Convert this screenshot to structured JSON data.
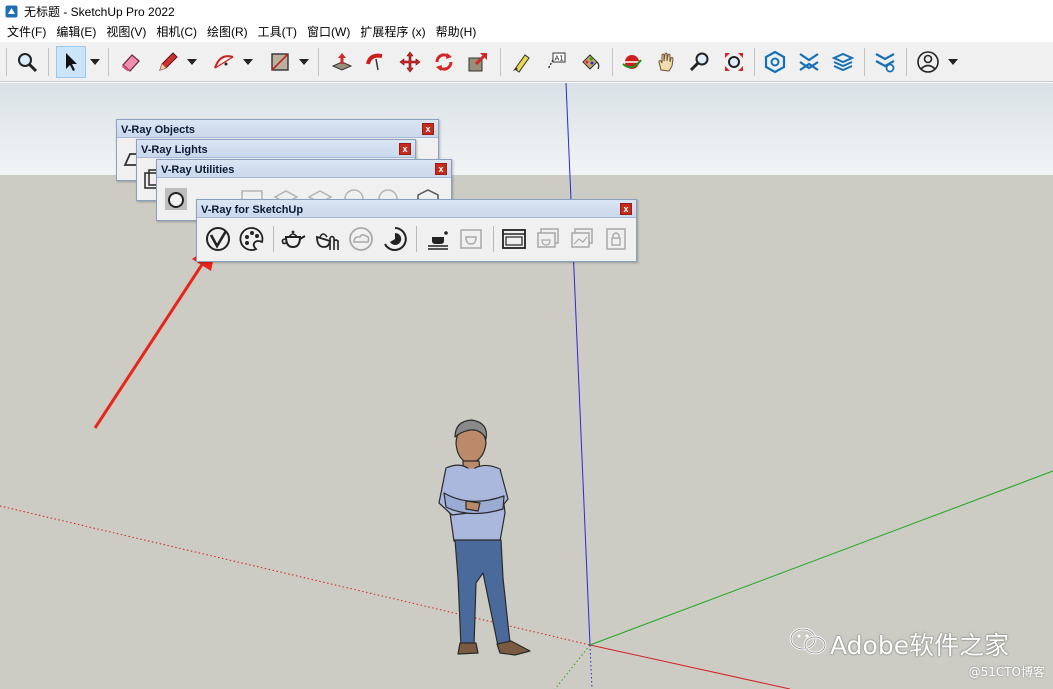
{
  "window": {
    "title": "无标题 - SketchUp Pro 2022"
  },
  "menu": [
    {
      "label": "文件(F)"
    },
    {
      "label": "编辑(E)"
    },
    {
      "label": "视图(V)"
    },
    {
      "label": "相机(C)"
    },
    {
      "label": "绘图(R)"
    },
    {
      "label": "工具(T)"
    },
    {
      "label": "窗口(W)"
    },
    {
      "label": "扩展程序 (x)"
    },
    {
      "label": "帮助(H)"
    }
  ],
  "toolbar": {
    "icons": [
      "zoom-icon",
      "select-icon",
      "eraser-icon",
      "pencil-icon",
      "arc-icon",
      "rectangle-icon",
      "push-pull-icon",
      "follow-me-icon",
      "move-icon",
      "rotate-icon",
      "scale-icon",
      "tape-measure-icon",
      "text-icon",
      "paint-bucket-icon",
      "orbit-icon",
      "pan-icon",
      "zoom-tool-icon",
      "zoom-extents-icon",
      "3d-warehouse-icon",
      "extension-warehouse-icon",
      "layout-icon",
      "extension-manager-icon",
      "account-icon"
    ]
  },
  "panels": {
    "objects": {
      "title": "V-Ray Objects",
      "close": "x"
    },
    "lights": {
      "title": "V-Ray Lights",
      "close": "x"
    },
    "utilities": {
      "title": "V-Ray Utilities",
      "close": "x"
    },
    "main": {
      "title": "V-Ray for SketchUp",
      "close": "x"
    }
  },
  "watermark": {
    "text": "Adobe软件之家",
    "sub": "@51CTO博客"
  },
  "colors": {
    "sky": "#e9eef1",
    "ground": "#ccccc4",
    "axis_blue": "#2a2ad8",
    "axis_red": "#d62020",
    "axis_green": "#1aa81a",
    "arrow": "#e8251b",
    "panel_header": "#c9d8ec",
    "close_button": "#c42b1c"
  }
}
